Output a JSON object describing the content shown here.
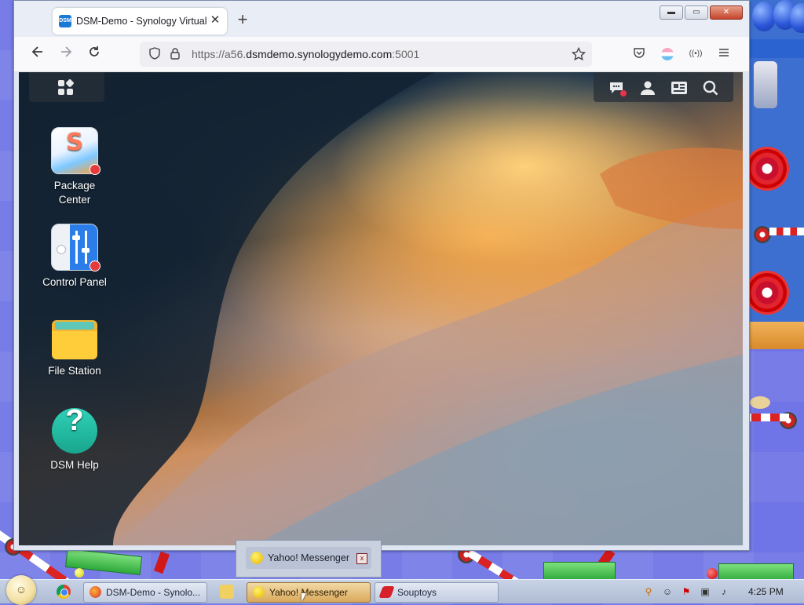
{
  "browser": {
    "tab_title": "DSM-Demo - Synology VirtualDSM",
    "favicon_label": "DSM",
    "new_tab": "+",
    "close_tab": "✕",
    "window_controls": {
      "minimize": "▬",
      "restore": "▭",
      "close": "✕"
    },
    "url": {
      "prefix": "https://a56.",
      "host": "dsmdemo.synologydemo.com",
      "suffix": ":5001"
    },
    "icons": [
      "back-icon",
      "forward-icon",
      "reload-icon",
      "shield-icon",
      "lock-icon",
      "star-icon",
      "pocket-icon",
      "account-icon",
      "extension-icon",
      "menu-icon"
    ]
  },
  "dsm": {
    "desktop_icons": [
      {
        "label_line1": "Package",
        "label_line2": "Center",
        "has_badge": true
      },
      {
        "label_line1": "Control Panel",
        "label_line2": "",
        "has_badge": true
      },
      {
        "label_line1": "File Station",
        "label_line2": "",
        "has_badge": false
      },
      {
        "label_line1": "DSM Help",
        "label_line2": "",
        "has_badge": false
      }
    ],
    "package_glyph": "S",
    "help_glyph": "?",
    "topbar_icons": [
      "chat-icon",
      "user-icon",
      "widgets-icon",
      "search-icon"
    ]
  },
  "popup": {
    "title": "Yahoo! Messenger",
    "close_glyph": "x"
  },
  "taskbar": {
    "buttons": [
      {
        "label": "DSM-Demo - Synolo...",
        "icon_color": "#e8642c"
      },
      {
        "label": "Yahoo! Messenger",
        "icon_color": "#f5c800"
      },
      {
        "label": "Souptoys",
        "icon_color": "#d8202a"
      }
    ],
    "clock": "4:25 PM"
  },
  "colors": {
    "accent": "#1b79d6",
    "badge_red": "#e53a3a",
    "active_task": "#d9a95b"
  }
}
